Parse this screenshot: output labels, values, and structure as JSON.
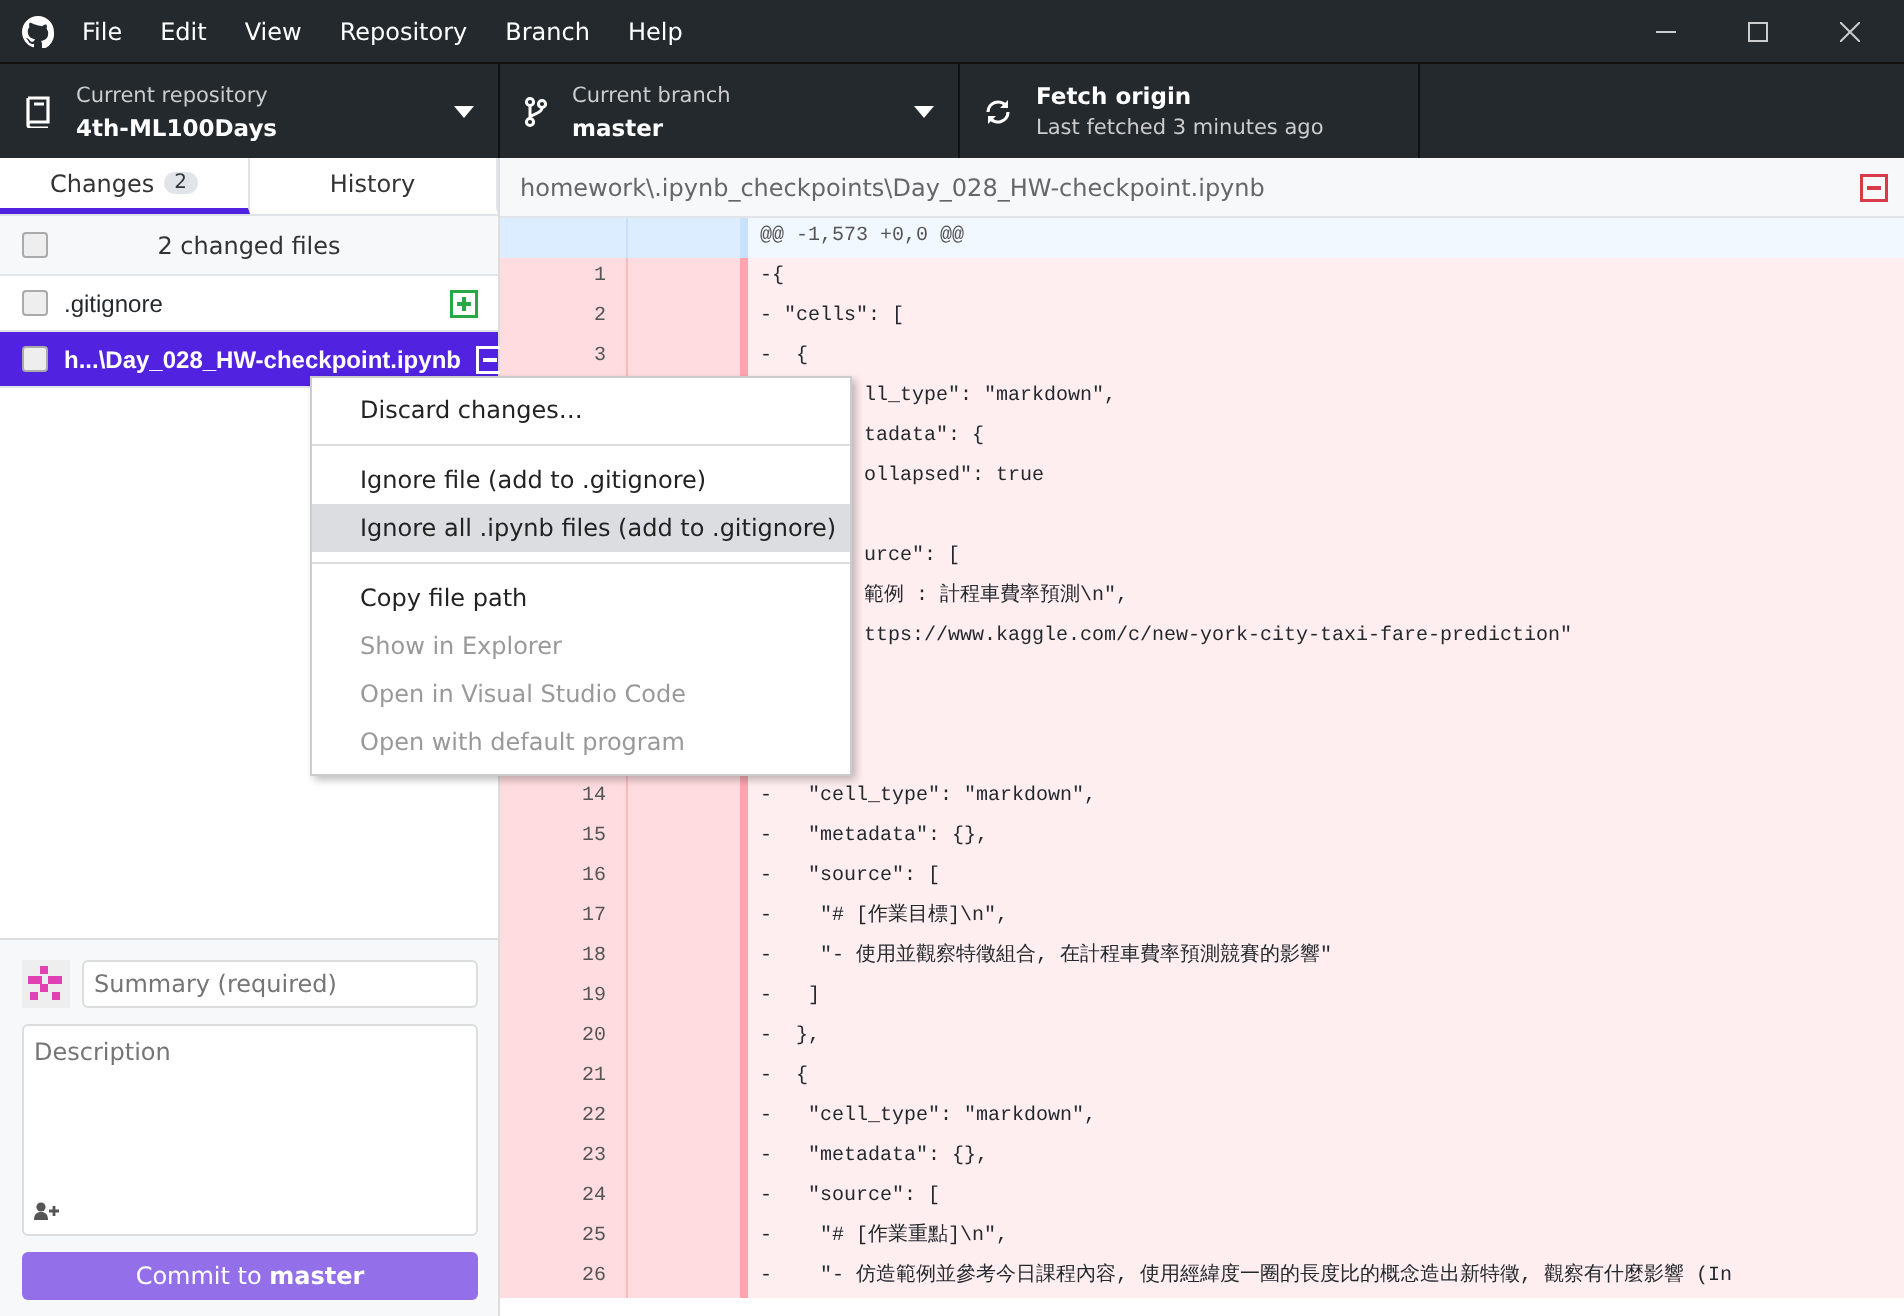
{
  "menu": [
    "File",
    "Edit",
    "View",
    "Repository",
    "Branch",
    "Help"
  ],
  "toolbar": {
    "repository": {
      "label": "Current repository",
      "value": "4th-ML100Days"
    },
    "branch": {
      "label": "Current branch",
      "value": "master"
    },
    "fetch": {
      "title": "Fetch origin",
      "subtitle": "Last fetched 3 minutes ago"
    }
  },
  "tabs": [
    {
      "label": "Changes",
      "count": "2",
      "selected": true
    },
    {
      "label": "History",
      "selected": false
    }
  ],
  "changes": {
    "header": "2 changed files",
    "checked": false,
    "files": [
      {
        "name": ".gitignore",
        "kind": "added",
        "checked": false,
        "selected": false
      },
      {
        "name": "h...\\Day_028_HW-checkpoint.ipynb",
        "kind": "deleted",
        "checked": false,
        "selected": true
      }
    ]
  },
  "commit": {
    "summary_placeholder": "Summary (required)",
    "description_placeholder": "Description",
    "button": "Commit to **master**",
    "disabled": true
  },
  "diff": {
    "path": "homework\\.ipynb_checkpoints\\Day_028_HW-checkpoint.ipynb",
    "hunk": "@@ -1,573 +0,0 @@",
    "lines": [
      {
        "kind": "line",
        "old": "1",
        "text": "-{"
      },
      {
        "kind": "line",
        "old": "2",
        "text": "- \"cells\": ["
      },
      {
        "kind": "line",
        "old": "3",
        "text": "-  {"
      },
      {
        "kind": "covered",
        "text": "ll_type\": \"markdown\","
      },
      {
        "kind": "covered",
        "text": "tadata\": {"
      },
      {
        "kind": "covered",
        "text": "ollapsed\": true"
      },
      {
        "kind": "covered"
      },
      {
        "kind": "covered",
        "text": "urce\": ["
      },
      {
        "kind": "covered",
        "text": "範例 : 計程車費率預測\\n\","
      },
      {
        "kind": "covered",
        "text": "ttps://www.kaggle.com/c/new-york-city-taxi-fare-prediction\""
      },
      {
        "kind": "covered"
      },
      {
        "kind": "covered"
      },
      {
        "kind": "covered"
      },
      {
        "kind": "line",
        "old": "14",
        "text": "-   \"cell_type\": \"markdown\","
      },
      {
        "kind": "line",
        "old": "15",
        "text": "-   \"metadata\": {},"
      },
      {
        "kind": "line",
        "old": "16",
        "text": "-   \"source\": ["
      },
      {
        "kind": "line",
        "old": "17",
        "text": "-    \"# [作業目標]\\n\","
      },
      {
        "kind": "line",
        "old": "18",
        "text": "-    \"- 使用並觀察特徵組合, 在計程車費率預測競賽的影響\""
      },
      {
        "kind": "line",
        "old": "19",
        "text": "-   ]"
      },
      {
        "kind": "line",
        "old": "20",
        "text": "-  },"
      },
      {
        "kind": "line",
        "old": "21",
        "text": "-  {"
      },
      {
        "kind": "line",
        "old": "22",
        "text": "-   \"cell_type\": \"markdown\","
      },
      {
        "kind": "line",
        "old": "23",
        "text": "-   \"metadata\": {},"
      },
      {
        "kind": "line",
        "old": "24",
        "text": "-   \"source\": ["
      },
      {
        "kind": "line",
        "old": "25",
        "text": "-    \"# [作業重點]\\n\","
      },
      {
        "kind": "line",
        "old": "26",
        "text": "-    \"- 仿造範例並參考今日課程內容, 使用經緯度一圈的長度比的概念造出新特徵, 觀察有什麼影響 (In"
      }
    ]
  },
  "context_menu": {
    "groups": [
      [
        {
          "label": "Discard changes…",
          "disabled": false,
          "selected": false
        }
      ],
      [
        {
          "label": "Ignore file (add to .gitignore)",
          "disabled": false,
          "selected": false
        },
        {
          "label": "Ignore all .ipynb files (add to .gitignore)",
          "disabled": false,
          "selected": true
        }
      ],
      [
        {
          "label": "Copy file path",
          "disabled": false,
          "selected": false
        },
        {
          "label": "Show in Explorer",
          "disabled": true,
          "selected": false
        },
        {
          "label": "Open in Visual Studio Code",
          "disabled": true,
          "selected": false
        },
        {
          "label": "Open with default program",
          "disabled": true,
          "selected": false
        }
      ]
    ]
  }
}
